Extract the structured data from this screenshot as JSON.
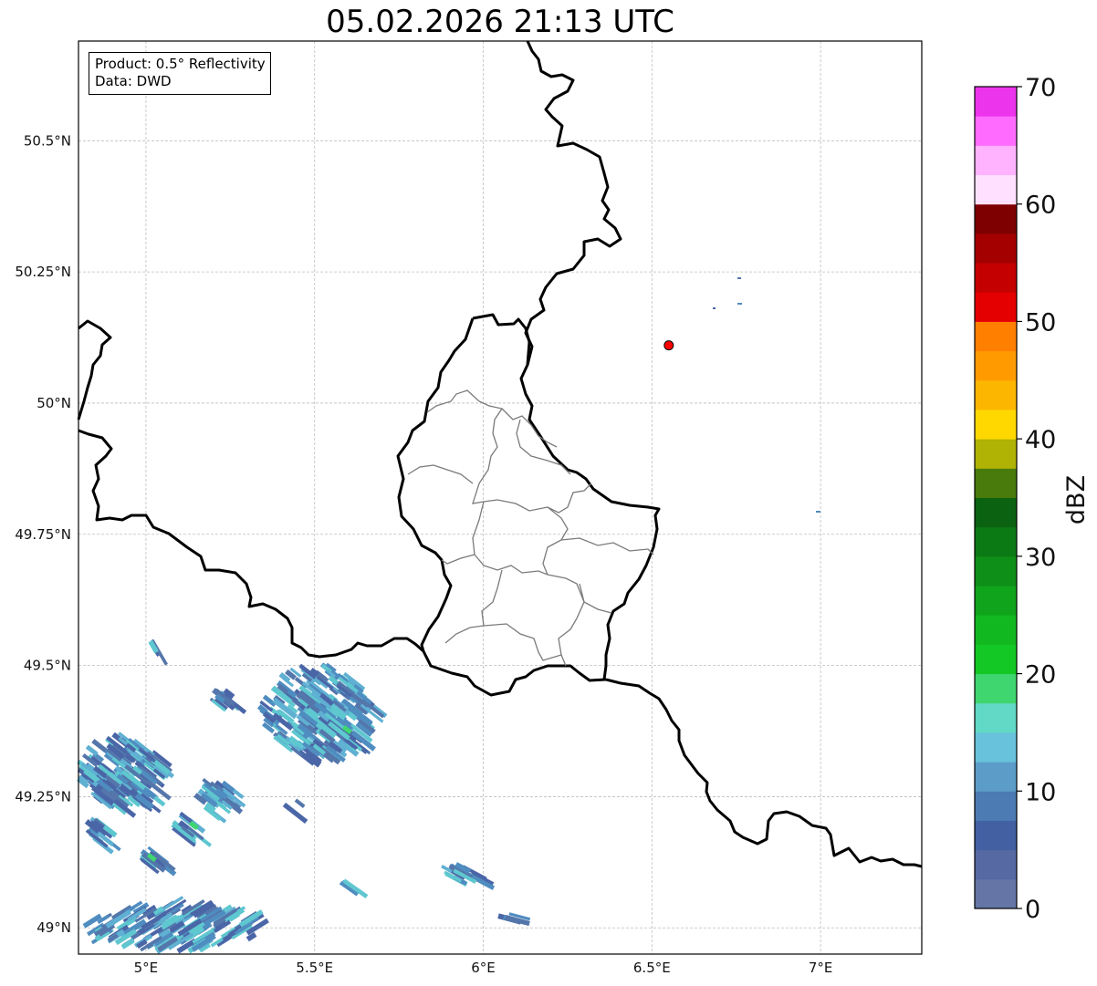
{
  "title": "05.02.2026 21:13 UTC",
  "info": {
    "product": "Product: 0.5° Reflectivity",
    "data": "Data: DWD"
  },
  "map": {
    "lon_range": [
      4.8,
      7.3
    ],
    "lat_range": [
      48.95,
      50.69
    ],
    "grid": true,
    "lon_ticks": [
      {
        "value": 5.0,
        "label": "5°E"
      },
      {
        "value": 5.5,
        "label": "5.5°E"
      },
      {
        "value": 6.0,
        "label": "6°E"
      },
      {
        "value": 6.5,
        "label": "6.5°E"
      },
      {
        "value": 7.0,
        "label": "7°E"
      }
    ],
    "lat_ticks": [
      {
        "value": 49.0,
        "label": "49°N"
      },
      {
        "value": 49.25,
        "label": "49.25°N"
      },
      {
        "value": 49.5,
        "label": "49.5°N"
      },
      {
        "value": 49.75,
        "label": "49.75°N"
      },
      {
        "value": 50.0,
        "label": "50°N"
      },
      {
        "value": 50.25,
        "label": "50.25°N"
      },
      {
        "value": 50.5,
        "label": "50.5°N"
      }
    ],
    "station_marker": {
      "lon": 6.55,
      "lat": 50.11,
      "color": "#ff0000"
    }
  },
  "colorbar": {
    "label": "dBZ",
    "min": 0,
    "max": 70,
    "step": 2.5,
    "ticks": [
      {
        "value": 0,
        "label": "0"
      },
      {
        "value": 10,
        "label": "10"
      },
      {
        "value": 20,
        "label": "20"
      },
      {
        "value": 30,
        "label": "30"
      },
      {
        "value": 40,
        "label": "40"
      },
      {
        "value": 50,
        "label": "50"
      },
      {
        "value": 60,
        "label": "60"
      },
      {
        "value": 70,
        "label": "70"
      }
    ],
    "colors": [
      "#6475a6",
      "#5669a3",
      "#4260a2",
      "#4b7bb2",
      "#5b9dc8",
      "#68c2dc",
      "#62d8c6",
      "#3fd66f",
      "#13c824",
      "#12b820",
      "#10a41c",
      "#0e8f18",
      "#0b7a14",
      "#0b6211",
      "#487b0c",
      "#b0b204",
      "#ffd800",
      "#fdb600",
      "#ff9b00",
      "#ff7f00",
      "#e40000",
      "#c40000",
      "#a40000",
      "#7e0000",
      "#ffe0ff",
      "#ffb3ff",
      "#ff6bff",
      "#ec34ec"
    ]
  },
  "radar_palette": [
    "#4a66a7",
    "#5476ab",
    "#4f8cc0",
    "#5fb0d2",
    "#5ec7cf"
  ]
}
